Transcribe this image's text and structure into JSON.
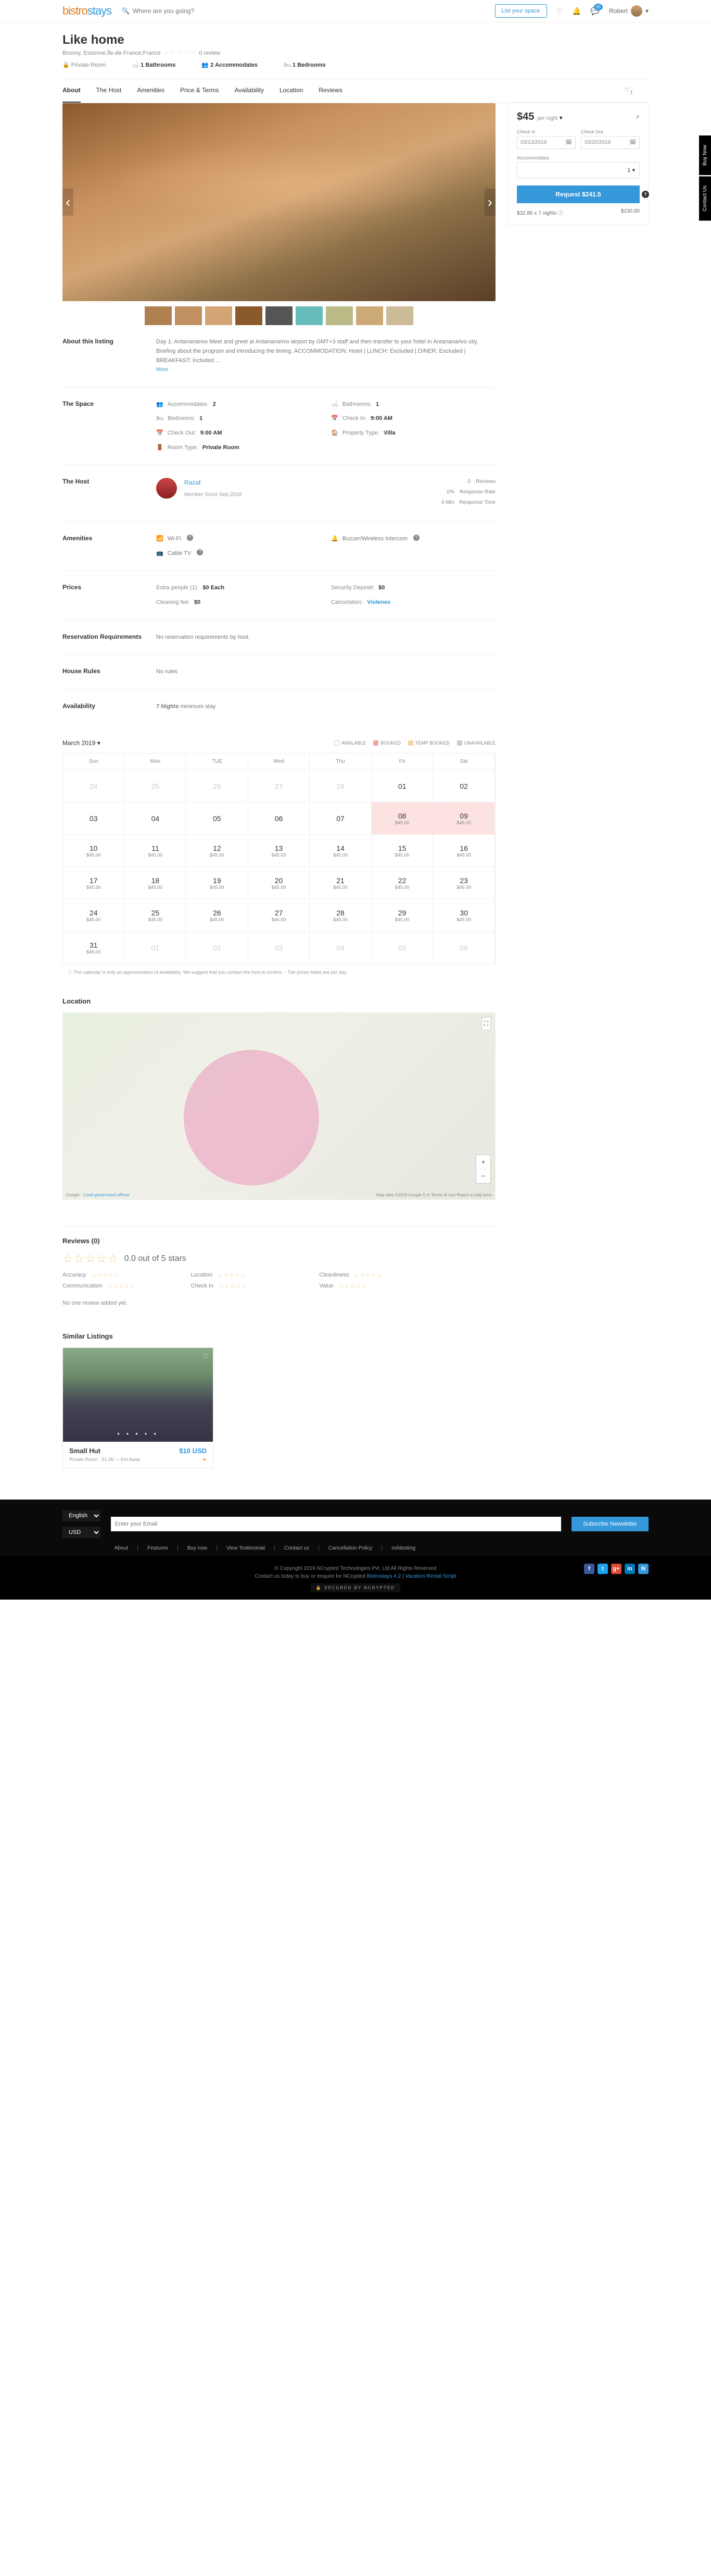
{
  "header": {
    "logo_1": "bistro",
    "logo_2": "stays",
    "search_placeholder": "Where are you going?",
    "list_button": "List your space",
    "msg_badge": "20",
    "user_name": "Robert"
  },
  "listing": {
    "title": "Like home",
    "location": "Brunoy, Essonne,Île-de-France,France",
    "review_count": "0 review",
    "features": {
      "room_type": "Private Room",
      "bathrooms": "1 Bathrooms",
      "accommodates": "2 Accommodates",
      "bedrooms": "1 Bedrooms"
    }
  },
  "tabs": [
    "About",
    "The Host",
    "Amenities",
    "Price & Terms",
    "Availability",
    "Location",
    "Reviews"
  ],
  "wishlist_count": "1",
  "sidetabs": [
    "Buy Now",
    "Contact Us"
  ],
  "booking": {
    "price": "$45",
    "per_night": "per night",
    "checkin_label": "Check In",
    "checkout_label": "Check Out",
    "checkin_value": "03/13/2019",
    "checkout_value": "03/20/2019",
    "accommodates_label": "Accommodates",
    "accommodates_value": "1",
    "request_label": "Request  $241.5",
    "calc_left": "$32.86 x 7 nights",
    "calc_right": "$230.00"
  },
  "about": {
    "heading": "About this listing",
    "body": "Day 1: Antananarivo Meet and greet at Antananarivo airport by GMT+3 staff and then transfer to your hotel in Antananarivo city. Briefing about the program and introducing the timing. ACCOMMODATION: Hotel | LUNCH: Excluded | DINER: Excluded | BREAKFAST: Included ...",
    "more": "More"
  },
  "space": {
    "heading": "The Space",
    "items": {
      "accommodates_k": "Accommodates:",
      "accommodates_v": "2",
      "bathrooms_k": "Bathrooms:",
      "bathrooms_v": "1",
      "bedrooms_k": "Bedrooms:",
      "bedrooms_v": "1",
      "checkin_k": "Check In:",
      "checkin_v": "9:00 AM",
      "checkout_k": "Check Out:",
      "checkout_v": "9:00 AM",
      "property_k": "Property Type:",
      "property_v": "Villa",
      "roomtype_k": "Room Type:",
      "roomtype_v": "Private Room"
    }
  },
  "host": {
    "heading": "The Host",
    "name": "Razaf",
    "since": "Member Since Sep,2018",
    "reviews_k": "Reviews",
    "reviews_v": "0",
    "rate_k": "Response Rate",
    "rate_v": "0%",
    "time_k": "Response Time",
    "time_v": "0 Min"
  },
  "amenities": {
    "heading": "Amenities",
    "items": [
      "Wi-FI",
      "Buzzer/Wireless Intercom",
      "Cable TV"
    ]
  },
  "prices": {
    "heading": "Prices",
    "extra_k": "Extra people (1):",
    "extra_v": "$0 Each",
    "clean_k": "Cleaning fee:",
    "clean_v": "$0",
    "deposit_k": "Security Deposit:",
    "deposit_v": "$0",
    "cancel_k": "Cancelation:",
    "cancel_v": "Violenex"
  },
  "reservation": {
    "heading": "Reservation Requirements",
    "body": "No reservation requirements by host."
  },
  "rules": {
    "heading": "House Rules",
    "body": "No rules"
  },
  "availability": {
    "heading": "Availability",
    "min_stay_v": "7 Nights",
    "min_stay_t": "minimum stay",
    "month": "March 2019",
    "legend": {
      "a": "AVAILABLE",
      "b": "BOOKED",
      "t": "TEMP BOOKED",
      "u": "UNAVAILABLE"
    },
    "days": [
      "Sun",
      "Mon",
      "TUE",
      "Wed",
      "Thu",
      "Fri",
      "Sat"
    ],
    "note": "The calendar is only an approximation of availability. We suggest that you contact the host to confirm.\n- The prices listed are per day.",
    "cells": [
      {
        "d": "24",
        "dis": true
      },
      {
        "d": "25",
        "dis": true
      },
      {
        "d": "26",
        "dis": true
      },
      {
        "d": "27",
        "dis": true
      },
      {
        "d": "28",
        "dis": true
      },
      {
        "d": "01"
      },
      {
        "d": "02"
      },
      {
        "d": "03"
      },
      {
        "d": "04"
      },
      {
        "d": "05"
      },
      {
        "d": "06"
      },
      {
        "d": "07"
      },
      {
        "d": "08",
        "p": "$45.00",
        "booked": true
      },
      {
        "d": "09",
        "p": "$45.00",
        "booked": true
      },
      {
        "d": "10",
        "p": "$45.00"
      },
      {
        "d": "11",
        "p": "$45.00"
      },
      {
        "d": "12",
        "p": "$45.00"
      },
      {
        "d": "13",
        "p": "$45.00"
      },
      {
        "d": "14",
        "p": "$45.00"
      },
      {
        "d": "15",
        "p": "$45.00"
      },
      {
        "d": "16",
        "p": "$45.00"
      },
      {
        "d": "17",
        "p": "$45.00"
      },
      {
        "d": "18",
        "p": "$45.00"
      },
      {
        "d": "19",
        "p": "$45.00"
      },
      {
        "d": "20",
        "p": "$45.00"
      },
      {
        "d": "21",
        "p": "$45.00"
      },
      {
        "d": "22",
        "p": "$45.00"
      },
      {
        "d": "23",
        "p": "$45.00"
      },
      {
        "d": "24",
        "p": "$45.00"
      },
      {
        "d": "25",
        "p": "$45.00"
      },
      {
        "d": "26",
        "p": "$45.00"
      },
      {
        "d": "27",
        "p": "$45.00"
      },
      {
        "d": "28",
        "p": "$45.00"
      },
      {
        "d": "29",
        "p": "$45.00"
      },
      {
        "d": "30",
        "p": "$45.00"
      },
      {
        "d": "31",
        "p": "$45.00"
      },
      {
        "d": "01",
        "dis": true
      },
      {
        "d": "02",
        "dis": true
      },
      {
        "d": "03",
        "dis": true
      },
      {
        "d": "04",
        "dis": true
      },
      {
        "d": "05",
        "dis": true
      },
      {
        "d": "06",
        "dis": true
      }
    ]
  },
  "location": {
    "heading": "Location",
    "google": "Google",
    "attr": "Local government offices",
    "terms": "Map data ©2019 Google   5 m   Terms of Use   Report a map error"
  },
  "reviews": {
    "heading": "Reviews (0)",
    "score": "0.0 out of 5 stars",
    "cats": [
      "Accuracy",
      "Location",
      "Cleanliness",
      "Communication",
      "Check In",
      "Value"
    ],
    "none": "No one review added yet."
  },
  "similar": {
    "heading": "Similar Listings",
    "card": {
      "title": "Small Hut",
      "price": "$10 USD",
      "sub": "Private Room · 51.96 — Km Away",
      "stars": "★"
    }
  },
  "footer": {
    "lang": "English",
    "curr": "USD",
    "nl_placeholder": "Enter your Email",
    "nl_button": "Subscribe Newsletter",
    "links": [
      "About",
      "Features",
      "Buy now",
      "View Testimonial",
      "Contact us",
      "Cancellation Policy",
      "nshtesting"
    ],
    "copy1": "© Copyright 2019 NCrypted Technologies Pvt. Ltd All Rights Reserved",
    "copy2_a": "Contact us today to buy or enquire for NCrypted ",
    "copy2_b": "Bistrostays 4.2",
    "copy2_c": " | ",
    "copy2_d": "Vacation Rental Script",
    "secured": "SECURED BY  NCRYPTED"
  }
}
